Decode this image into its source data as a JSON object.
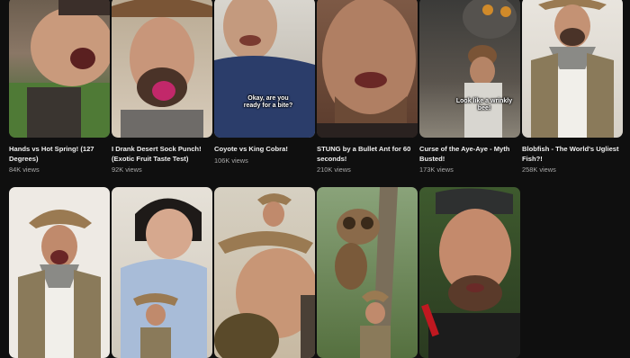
{
  "shorts": [
    {
      "title": "Hands vs Hot Spring! (127 Degrees)",
      "views": "84K views",
      "caption": ""
    },
    {
      "title": "I Drank Desert Sock Punch! (Exotic Fruit Taste Test)",
      "views": "92K views",
      "caption": ""
    },
    {
      "title": "Coyote vs King Cobra!",
      "views": "106K views",
      "caption": "Okay, are you ready for a bite?"
    },
    {
      "title": "STUNG by a Bullet Ant for 60 seconds!",
      "views": "210K views",
      "caption": ""
    },
    {
      "title": "Curse of the Aye-Aye - Myth Busted!",
      "views": "173K views",
      "caption": "Look like a wrinkly bee!"
    },
    {
      "title": "Blobfish - The World's Ugliest Fish?!",
      "views": "258K views",
      "caption": ""
    }
  ],
  "row2": [
    {
      "name": "short-thumbnail-7"
    },
    {
      "name": "short-thumbnail-8"
    },
    {
      "name": "short-thumbnail-9"
    },
    {
      "name": "short-thumbnail-10"
    },
    {
      "name": "short-thumbnail-11"
    }
  ],
  "colors": {
    "background": "#0f0f0f",
    "title": "#f1f1f1",
    "meta": "#aaaaaa"
  }
}
